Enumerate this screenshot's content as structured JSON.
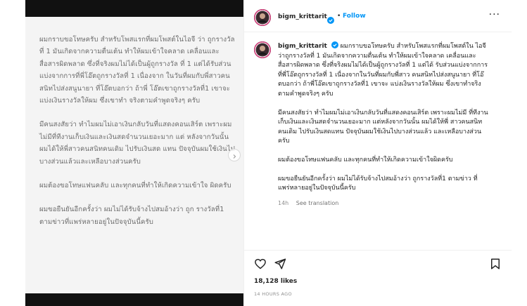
{
  "post": {
    "username": "bigm_krittarit",
    "separator": "•",
    "follow_label": "Follow",
    "more_label": "···",
    "likes": "18,128 likes",
    "time": "14 HOURS AGO"
  },
  "media": {
    "paragraphs": [
      "ผมกราบขอโทษครับ สำหรับโพสแรกที่ผมโพสต์ในไอจี ว่า ถูกรางวัลที่ 1 มันเกิดจากความตื่นเต้น ทำให้ผมเข้าใจคลาด เคลื่อนและสื่อสารผิดพลาด ซึ่งที่จริงผมไม่ได้เป็นผู้ถูกรางวัล ที่ 1 แต่ได้รับส่วนแบ่งจากการที่พี่โอ๊ตถูกรางวัลที่ 1 เนื่องจาก ในวันที่ผมกับพี่สาวคนสนิทไปส่งสนูนายา ที่โอ๊ตบอกว่า ถ้าพี่ โอ๊ตเขาถูกรางวัลที่1 เขาจะแบ่งเงินรางวัลให้ผม ซึ่งเขาทำ จริงตามคำพูดจริงๆ ครับ",
      "มีคนสงสัยว่า ทำไมผมไม่เอาเงินกลับวันที่แสดงคอนเสิร์ต เพราะผมไม่มีที่ทีงานเก็บเงินและเงินสดจำนวนเยอะมาก แต่ หลังจากวันนั้น ผมได้ให้พี่สาวคนสนิทคนเดิม ไปรับเงินสด แทน ปัจจุบันผมใช้เงินไปบางส่วนแล้วและเหลือบางส่วนครับ",
      "ผมต้องขอโทษแฟนคลับ และทุกคนที่ทำให้เกิดความเข้าใจ ผิดครับ",
      "ผมขอยืนยันอีกครั้งว่า ผมไม่ได้รับจ้างไปสมอ้างว่า ถูก รางวัลที่1 ตามข่าวที่แพร่หลายอยู่ในปัจจุบันนี้ครับ"
    ]
  },
  "caption": {
    "paragraphs": [
      "ผมกราบขอโทษครับ สำหรับโพสแรกที่ผมโพสต์ใน ไอจี ว่าถูกรางวัลที่ 1 มันเกิดจากความตื่นเต้น ทำให้ผมเข้าใจคลาด เคลื่อนและสื่อสารผิดพลาด ซึ่งที่จริงผมไม่ได้เป็นผู้ถูกรางวัลที่ 1 แต่ได้ รับส่วนแบ่งจากการที่พี่โอ๊ตถูกรางวัลที่ 1 เนื่องจากในวันที่ผมกับพี่สาว คนสนิทไปส่งสนูนายา ที่โอ๊ตบอกว่า ถ้าพี่โอ๊ตเขาถูกรางวัลที่1 เขาจะ แบ่งเงินรางวัลให้ผม ซึ่งเขาทำจริงตามคำพูดจริงๆ ครับ",
      "มีคนสงสัยว่า ทำไมผมไม่เอาเงินกลับวันที่แสดงคอนเสิร์ต เพราะผมไม่มี ที่ทีงานเก็บเงินและเงินสดจำนวนเยอะมาก แต่หลังจากวันนั้น ผมได้ให้พี่ สาวคนสนิทคนเดิม ไปรับเงินสดแทน ปัจจุบันผมใช้เงินไปบางส่วนแล้ว และเหลือบางส่วนครับ",
      "ผมต้องขอโทษแฟนคลับ และทุกคนที่ทำให้เกิดความเข้าใจผิดครับ",
      "ผมขอยืนยันอีกครั้งว่า ผมไม่ได้รับจ้างไปสมอ้างว่า ถูกรางวัลที่1 ตามข่าว ที่แพร่หลายอยู่ในปัจจุบันนี้ครับ"
    ],
    "age": "14h",
    "see_translation": "See translation"
  },
  "icons": {
    "verified": "verified-badge-icon",
    "like": "heart-icon",
    "share": "paper-plane-icon",
    "save": "bookmark-icon",
    "next": "chevron-right-icon"
  },
  "colors": {
    "accent": "#0095f6",
    "text": "#262626",
    "muted": "#8e8e8e",
    "media_text": "#6b6b6b",
    "media_bg": "#f4f4f4"
  }
}
